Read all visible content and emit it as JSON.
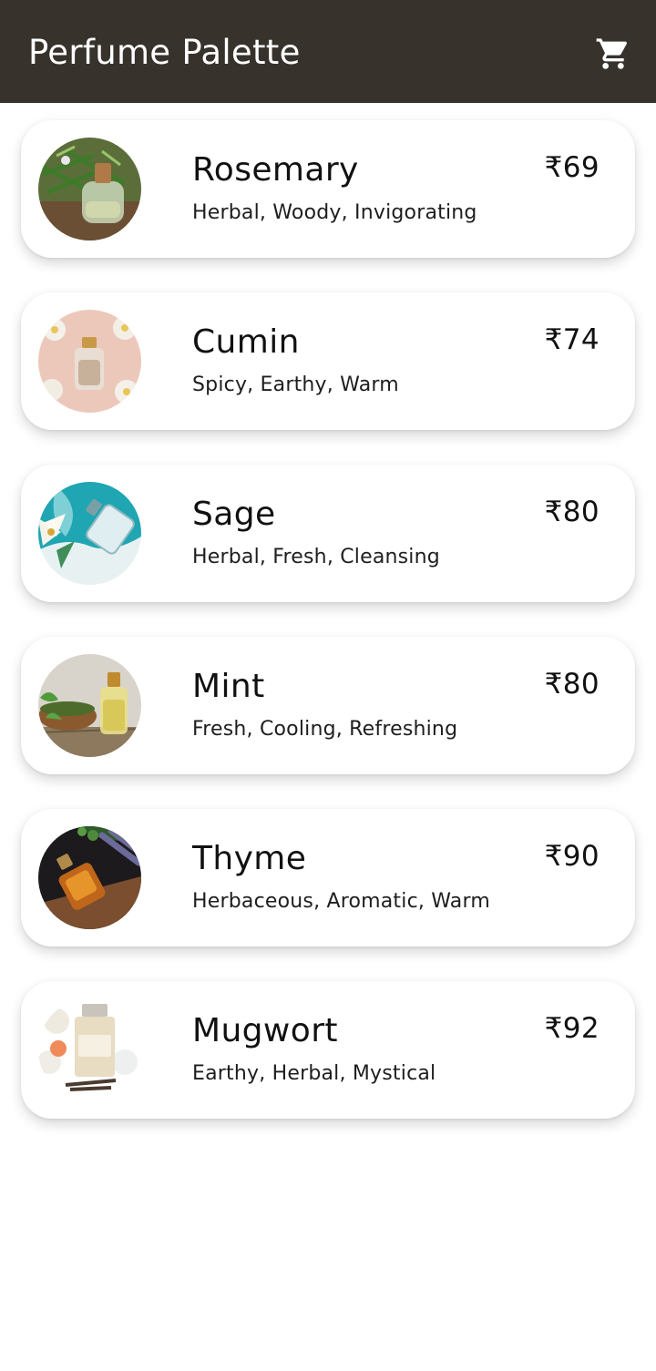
{
  "app": {
    "title": "Perfume Palette",
    "cart_icon": "shopping-cart-icon",
    "bar_color": "#37332c"
  },
  "products": [
    {
      "name": "Rosemary",
      "notes": "Herbal, Woody, Invigorating",
      "price": "₹69"
    },
    {
      "name": "Cumin",
      "notes": "Spicy, Earthy, Warm",
      "price": "₹74"
    },
    {
      "name": "Sage",
      "notes": "Herbal, Fresh, Cleansing",
      "price": "₹80"
    },
    {
      "name": "Mint",
      "notes": "Fresh, Cooling, Refreshing",
      "price": "₹80"
    },
    {
      "name": "Thyme",
      "notes": "Herbaceous, Aromatic, Warm",
      "price": "₹90"
    },
    {
      "name": "Mugwort",
      "notes": "Earthy, Herbal, Mystical",
      "price": "₹92"
    }
  ]
}
